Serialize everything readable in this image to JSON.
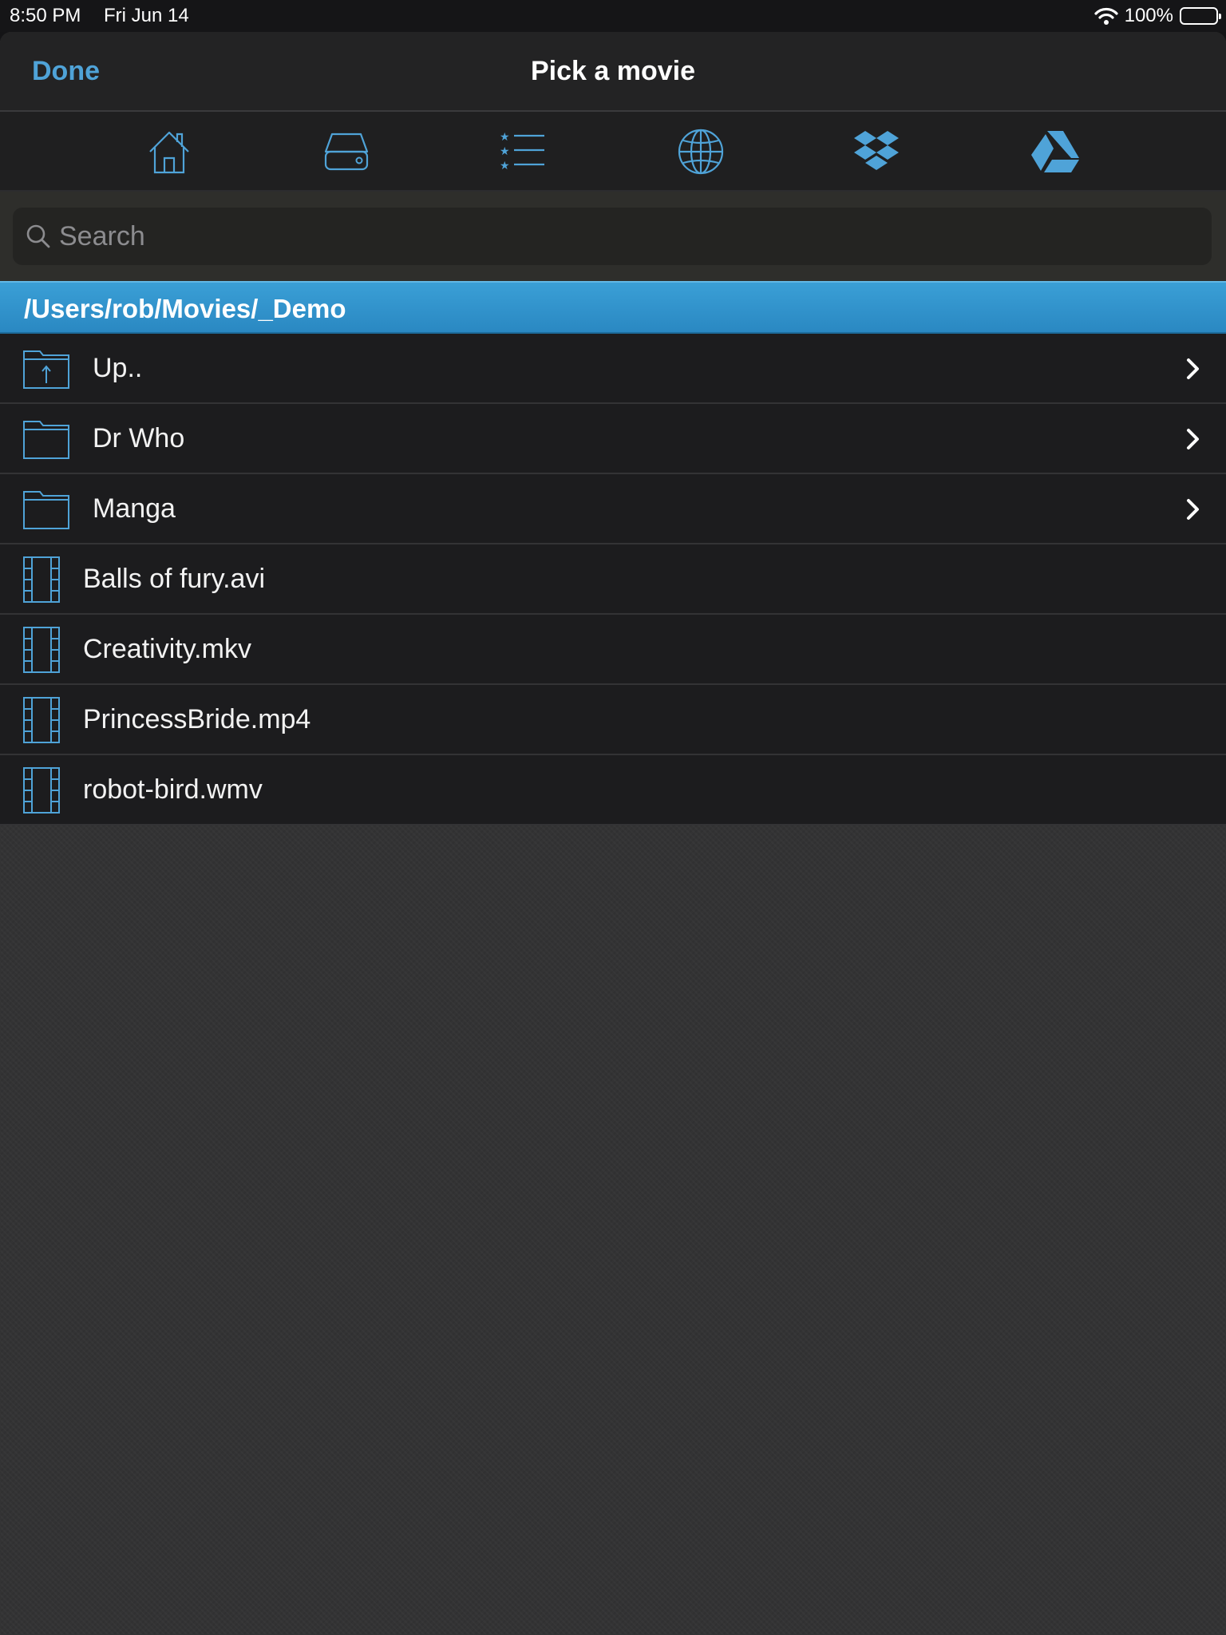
{
  "status_bar": {
    "time": "8:50 PM",
    "date": "Fri Jun 14",
    "battery_text": "100%",
    "battery_level": 1.0
  },
  "navbar": {
    "done_label": "Done",
    "title": "Pick a movie"
  },
  "toolbar": {
    "icons": [
      "home-icon",
      "hard-drive-icon",
      "favorites-list-icon",
      "globe-icon",
      "dropbox-icon",
      "google-drive-icon"
    ]
  },
  "search": {
    "placeholder": "Search",
    "value": ""
  },
  "path": "/Users/rob/Movies/_Demo",
  "items": [
    {
      "type": "folder-up",
      "label": "Up.."
    },
    {
      "type": "folder",
      "label": "Dr Who"
    },
    {
      "type": "folder",
      "label": "Manga"
    },
    {
      "type": "file",
      "label": "Balls of fury.avi"
    },
    {
      "type": "file",
      "label": "Creativity.mkv"
    },
    {
      "type": "file",
      "label": "PrincessBride.mp4"
    },
    {
      "type": "file",
      "label": "robot-bird.wmv"
    }
  ],
  "colors": {
    "accent": "#4fa3d8",
    "path_bar": "#2f93cc",
    "row_background": "#1c1c1e",
    "sheet_background": "#333334"
  }
}
